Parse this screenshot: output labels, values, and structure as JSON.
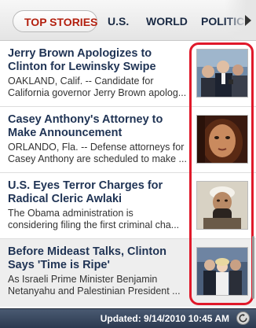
{
  "tabs": [
    {
      "label": "TOP STORIES",
      "active": true
    },
    {
      "label": "U.S.",
      "active": false
    },
    {
      "label": "WORLD",
      "active": false
    },
    {
      "label": "POLITICS",
      "active": false
    }
  ],
  "stories": [
    {
      "title_lines": [
        "Jerry Brown Apologizes to",
        "Clinton for Lewinsky Swipe"
      ],
      "summary_lines": [
        "OAKLAND, Calif. -- Candidate for",
        "California governor Jerry Brown apolog..."
      ]
    },
    {
      "title_lines": [
        "Casey Anthony's Attorney to",
        "Make Announcement"
      ],
      "summary_lines": [
        "ORLANDO, Fla. -- Defense attorneys for",
        "Casey Anthony are scheduled to make ..."
      ]
    },
    {
      "title_lines": [
        "U.S. Eyes Terror Charges for",
        "Radical Cleric Awlaki"
      ],
      "summary_lines": [
        "The Obama administration is",
        "considering filing the first criminal cha..."
      ]
    },
    {
      "title_lines": [
        "Before Mideast Talks, Clinton",
        "Says 'Time is Ripe'"
      ],
      "summary_lines": [
        "As Israeli Prime Minister Benjamin",
        "Netanyahu and Palestinian President ..."
      ]
    }
  ],
  "footer": {
    "updated": "Updated: 9/14/2010 10:45 AM"
  },
  "colors": {
    "active_tab": "#b3200f",
    "headline": "#1f3354",
    "highlight": "#e0192a",
    "footer_bg": "#2c3a50"
  }
}
